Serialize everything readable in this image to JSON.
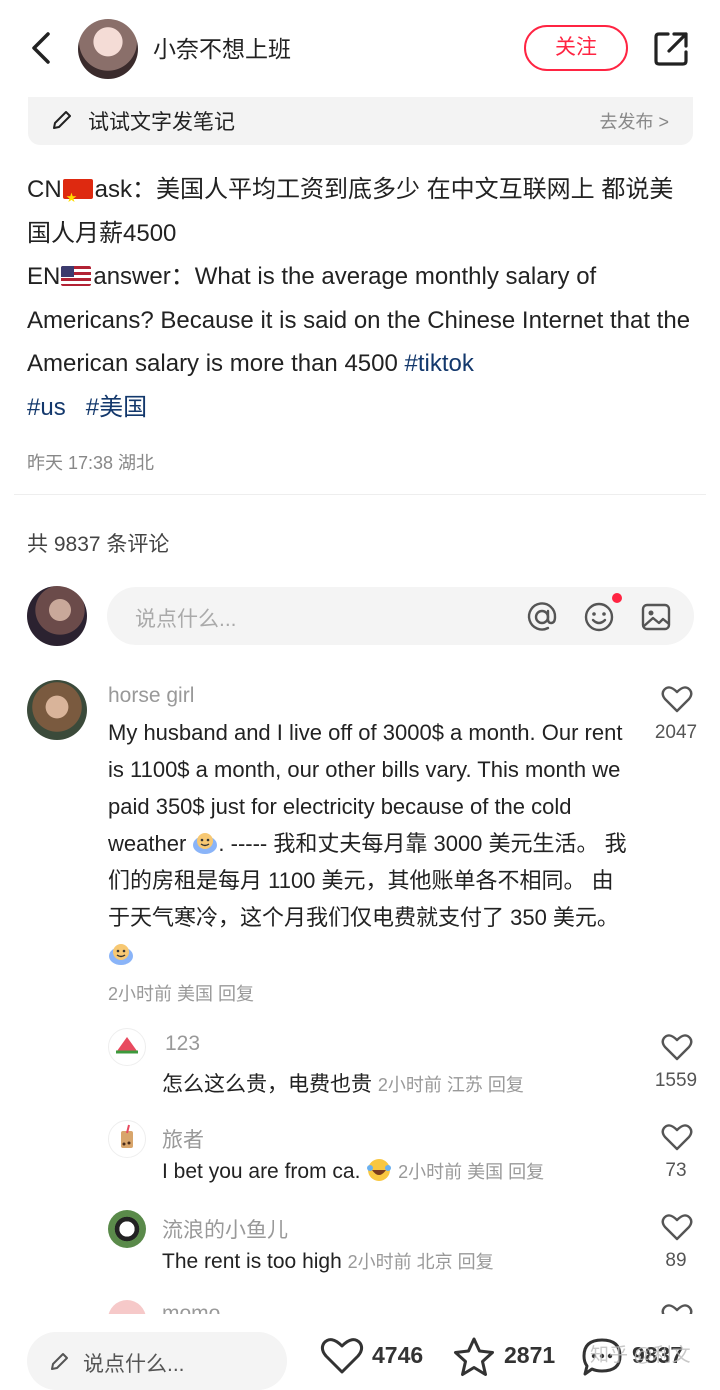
{
  "header": {
    "author": "小奈不想上班",
    "follow_label": "关注"
  },
  "try_bar": {
    "text": "试试文字发笔记",
    "publish": "去发布 >"
  },
  "post": {
    "cn_label": "CN",
    "cn_text": "ask：美国人平均工资到底多少 在中文互联网上 都说美国人月薪4500",
    "en_label": "EN",
    "en_text": "answer：What is the average monthly salary of Americans? Because it is said on the Chinese Internet that the American salary is more than 4500 ",
    "tags": [
      "#tiktok",
      "#us",
      "#美国"
    ],
    "meta": "昨天 17:38 湖北"
  },
  "comments_count": "共 9837 条评论",
  "comment_input": {
    "placeholder": "说点什么..."
  },
  "comments": [
    {
      "name": "horse girl",
      "text1": "My husband and I live off of 3000$ a month. Our rent is 1100$ a month, our other bills vary. This month we paid 350$ just for electricity because of the cold weather ",
      "text2": ". -----  我和丈夫每月靠 3000 美元生活。 我们的房租是每月 1100 美元，其他账单各不相同。 由于天气寒冷，这个月我们仅电费就支付了 350 美元。",
      "meta": "2小时前 美国 回复",
      "likes": "2047"
    }
  ],
  "replies": [
    {
      "name": "123",
      "text": "怎么这么贵，电费也贵",
      "meta": "2小时前 江苏 回复",
      "likes": "1559"
    },
    {
      "name": "旅者",
      "text": "I bet you are from ca. ",
      "meta": "2小时前 美国 回复",
      "likes": "73"
    },
    {
      "name": "流浪的小鱼儿",
      "text": "The rent is too high",
      "meta": "2小时前 北京 回复",
      "likes": "89"
    },
    {
      "name": "momo",
      "text": "",
      "meta": "",
      "likes": ""
    }
  ],
  "bottom": {
    "placeholder": "说点什么...",
    "likes": "4746",
    "stars": "2871",
    "comments": "9837",
    "watermark": "知乎 @利文"
  },
  "colors": {
    "accent": "#ff2442",
    "tag": "#13386c"
  }
}
